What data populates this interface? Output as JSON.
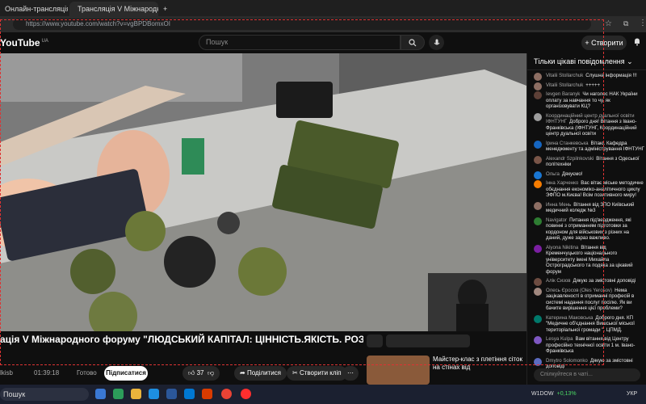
{
  "browser": {
    "tabs": [
      {
        "label": "Онлайн-трансляція V Між..."
      },
      {
        "label": "Трансляція V Міжнародн..."
      }
    ],
    "url": "https://www.youtube.com/watch?v=vgBPDBomxOI"
  },
  "youtube": {
    "logo": "YouTube",
    "country": "UA",
    "search_placeholder": "Пошук",
    "create_label": "Створити"
  },
  "video": {
    "title": "ація V Міжнародного форуму \"ЛЮДСЬКИЙ КАПІТАЛ: ЦІННІСТЬ.ЯКІСТЬ. РОЗВИТОК\"",
    "channel": "lkisb",
    "subscribers": "01:39:18",
    "status": "Готово",
    "subscribe_label": "Підписатися",
    "likes": "37",
    "share_label": "Поділитися",
    "clip_label": "Створити кліп"
  },
  "chat": {
    "header": "Тільки цікаві повідомлення",
    "input_placeholder": "Спілкуйтеся в чаті...",
    "messages": [
      {
        "author": "Vitalii Stollarchuk",
        "text": "Слушна інформація !!!",
        "color": "#8d6e63"
      },
      {
        "author": "Vitalii Stollarchuk",
        "text": "+++++",
        "color": "#8d6e63"
      },
      {
        "author": "Ievgen Baranyk",
        "text": "Чи наголос НАК України оплату за навчання то чу, як організовувати КЦ?",
        "color": "#5d4037"
      },
      {
        "author": "Координаційний центр дуальної освіти ІФНТУНГ",
        "text": "Доброго дня! Вітання з Івано-Франківська (ІФНТУНГ, Координаційний центр дуальної освіти",
        "color": "#9e9e9e"
      },
      {
        "author": "Ірина Станкевська",
        "text": "Вітаю. Кафедра менеджменту та адміністрування ІФНТУНГ",
        "color": "#1565c0"
      },
      {
        "author": "Alexandr Szpilnkovski",
        "text": "Вітання з Одеської політехніки",
        "color": "#795548"
      },
      {
        "author": "Ольга",
        "text": "Дякуємо!",
        "color": "#1976d2"
      },
      {
        "author": "Інна Харченко",
        "text": "Вас вітає міське методичне обєднання економіко-аналітичного циклу ЭФПО м.Києва! Всім позитивного миру!",
        "color": "#f57c00"
      },
      {
        "author": "Инна Мень",
        "text": "Вітання від ЗПО Київський медичний коледж №3",
        "color": "#8d6e63"
      },
      {
        "author": "Navigator",
        "text": "Питання під'вердження, які повинні з отриманням підготовки за кордоном для військових з різних на даний, дуже зараз важливо.",
        "color": "#2e7d32"
      },
      {
        "author": "Alyona Nikitina",
        "text": "Вітання від Кременчуцького національного університету імені Михайла Остроградського та подяка за цікавий форум",
        "color": "#7b1fa2"
      },
      {
        "author": "Алік Сизов",
        "text": "Дякую за змістовні доповіді",
        "color": "#6d4c41"
      },
      {
        "author": "Олесь Єросов (Oles Yerosov)",
        "text": "Нема зацікавленості в отриманні професій в системі надання послуг посілю. Як ви бачите вирішення цієї проблеми?",
        "color": "#a1887f"
      },
      {
        "author": "Катерина Маковська",
        "text": "Доброго дня. КП \"Медичне об'єднання Вишської міської територіальної громади \". ЦПМД.",
        "color": "#00796b"
      },
      {
        "author": "Lesya Kulpa",
        "text": "Вам вітання від Центру професійно технічної освіти 1 м. Івано-Франківська",
        "color": "#7e57c2"
      },
      {
        "author": "Dmytro Solomonko",
        "text": "Дякую за змістовні доповіді",
        "color": "#5c6bc0"
      }
    ]
  },
  "sidebar": {
    "next_title": "Майстер-клас з плетіння сіток на стінах від"
  },
  "taskbar": {
    "search": "Пошук",
    "ticker": "W1DOW",
    "ticker_change": "+0,13%",
    "lang": "УКР"
  }
}
